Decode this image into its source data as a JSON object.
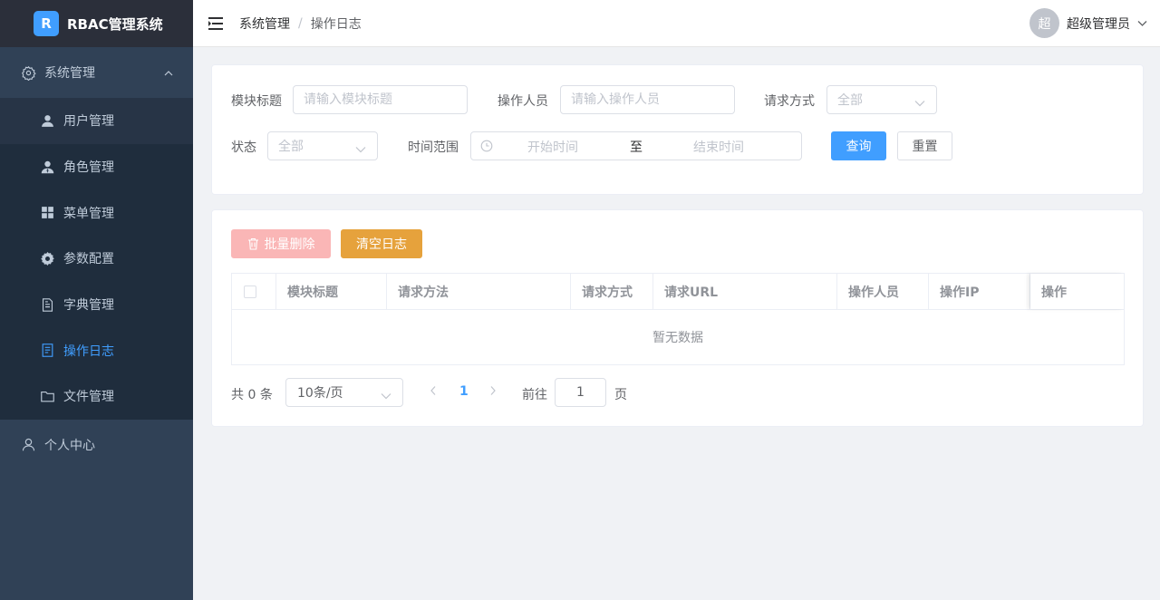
{
  "app": {
    "logo_letter": "R",
    "title": "RBAC管理系统"
  },
  "sidebar": {
    "parent_label": "系统管理",
    "items": [
      {
        "label": "用户管理",
        "icon": "user-icon"
      },
      {
        "label": "角色管理",
        "icon": "role-icon"
      },
      {
        "label": "菜单管理",
        "icon": "grid-icon"
      },
      {
        "label": "参数配置",
        "icon": "gear-filled-icon"
      },
      {
        "label": "字典管理",
        "icon": "document-icon"
      },
      {
        "label": "操作日志",
        "icon": "log-icon",
        "active": true
      },
      {
        "label": "文件管理",
        "icon": "folder-icon"
      }
    ],
    "personal_center": "个人中心"
  },
  "header": {
    "breadcrumb": [
      "系统管理",
      "操作日志"
    ],
    "breadcrumb_sep": "/",
    "avatar_text": "超",
    "username": "超级管理员"
  },
  "search": {
    "module_title_label": "模块标题",
    "module_title_placeholder": "请输入模块标题",
    "operator_label": "操作人员",
    "operator_placeholder": "请输入操作人员",
    "request_method_label": "请求方式",
    "request_method_value": "全部",
    "status_label": "状态",
    "status_value": "全部",
    "time_range_label": "时间范围",
    "start_placeholder": "开始时间",
    "range_separator": "至",
    "end_placeholder": "结束时间",
    "query_button": "查询",
    "reset_button": "重置"
  },
  "toolbar": {
    "batch_delete": "批量删除",
    "clear_log": "清空日志"
  },
  "table": {
    "columns": [
      "模块标题",
      "请求方法",
      "请求方式",
      "请求URL",
      "操作人员",
      "操作IP",
      "操作"
    ],
    "empty_text": "暂无数据"
  },
  "pagination": {
    "total_prefix": "共",
    "total": "0",
    "total_suffix": "条",
    "page_size": "10条/页",
    "current_page": "1",
    "goto_prefix": "前往",
    "goto_value": "1",
    "goto_suffix": "页"
  },
  "colors": {
    "primary": "#409eff",
    "sidebar_bg": "#304156",
    "warning": "#e6a23c",
    "danger_disabled": "#fab6b6"
  }
}
